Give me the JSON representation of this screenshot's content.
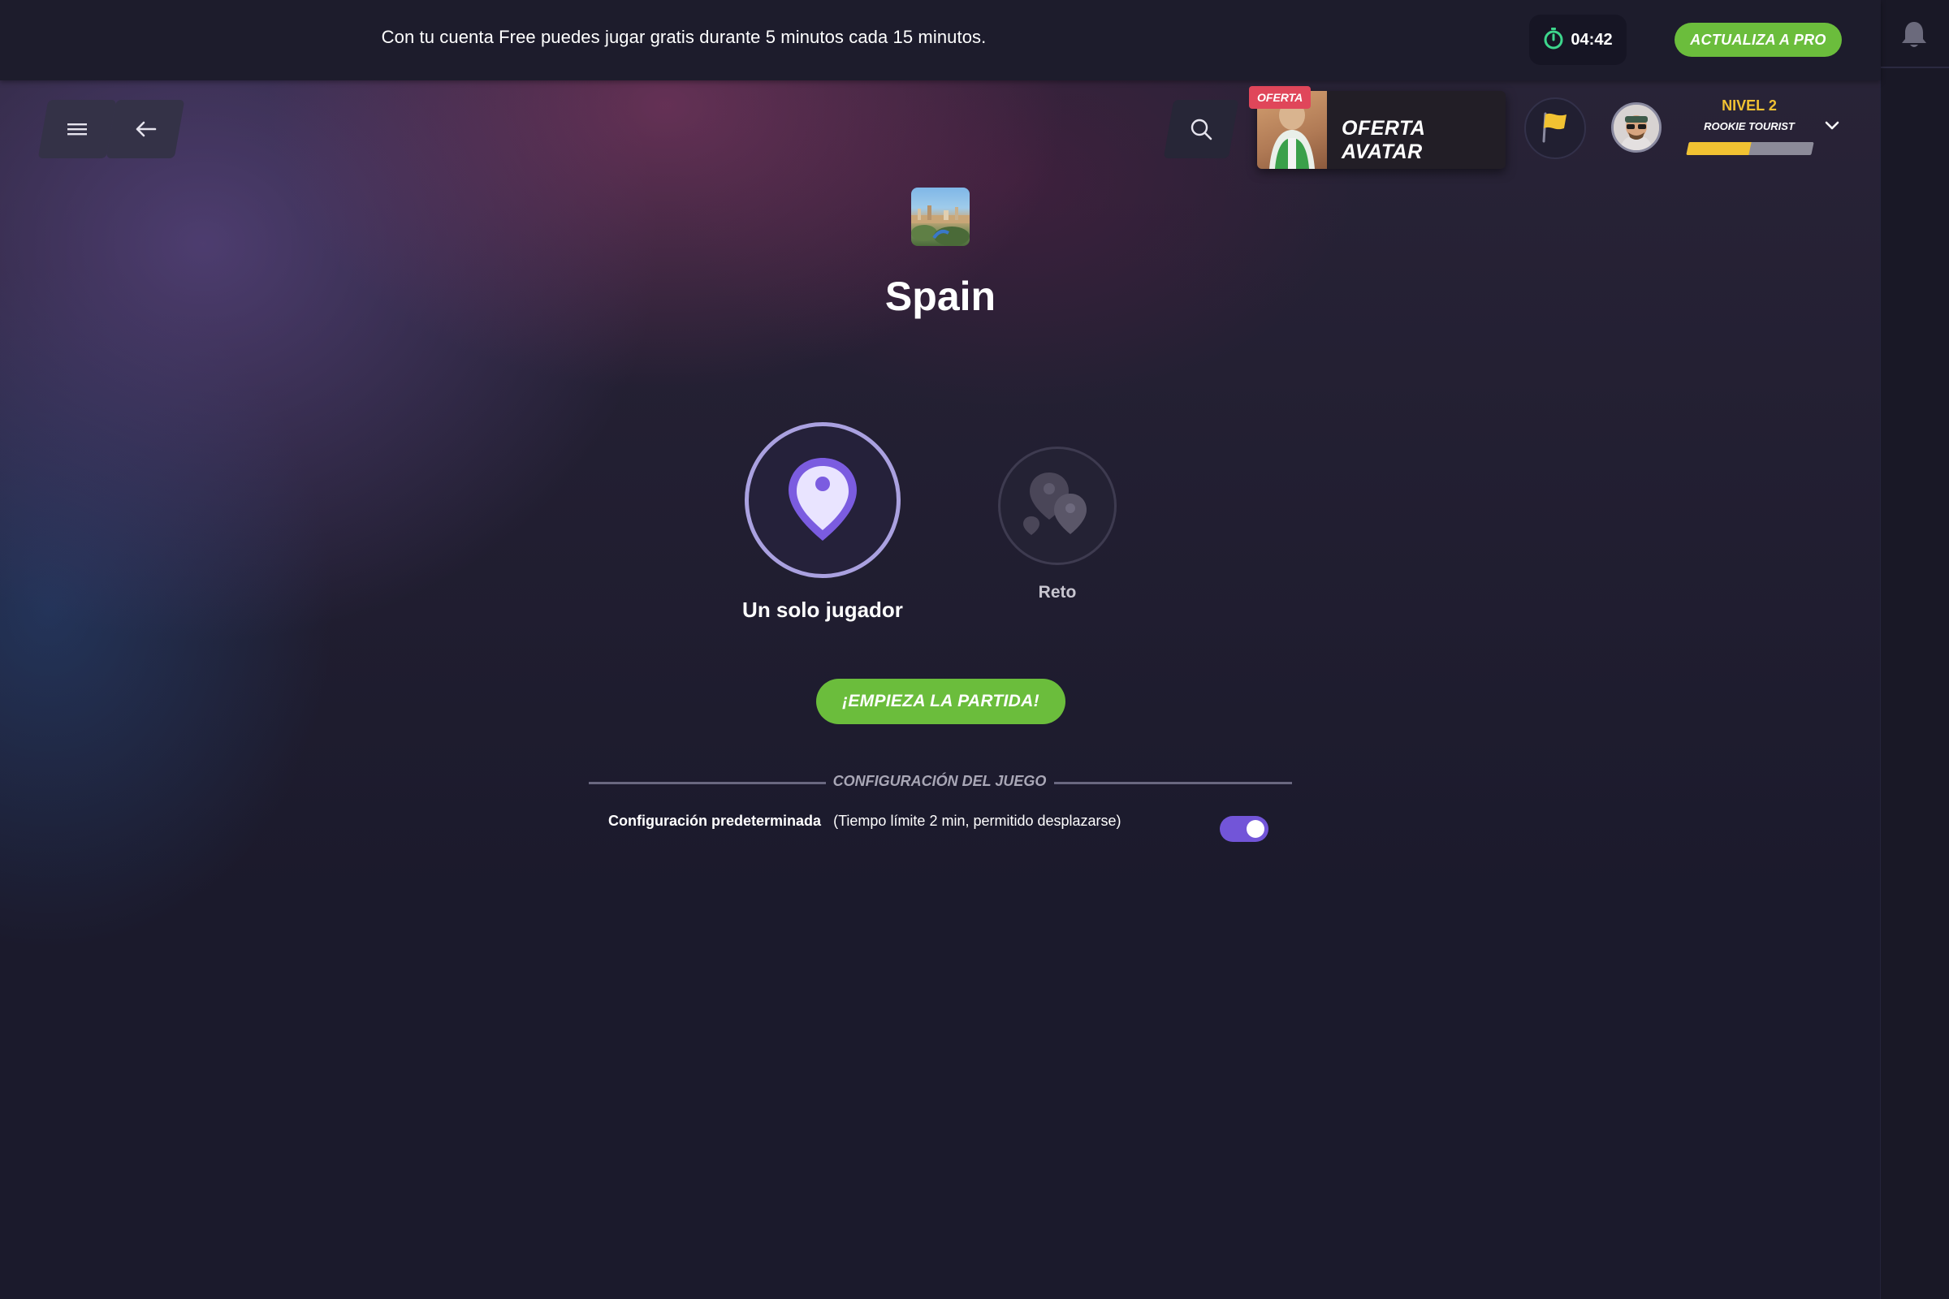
{
  "banner": {
    "message": "Con tu cuenta Free puedes jugar gratis durante 5 minutos cada 15 minutos.",
    "timer": "04:42",
    "timer_icon": "stopwatch-icon",
    "pro_button": "ACTUALIZA A PRO",
    "accent": "#6bbd3c"
  },
  "header": {
    "menu_icon": "hamburger-menu-icon",
    "back_icon": "arrow-left-icon",
    "search_icon": "search-icon",
    "offer": {
      "badge": "OFERTA",
      "title": "OFERTA AVATAR"
    },
    "flag_icon": "yellow-flag-icon",
    "level": {
      "label": "NIVEL 2",
      "title": "ROOKIE TOURIST",
      "progress": 0.5,
      "bar_color": "#f1c232"
    }
  },
  "country": {
    "name": "Spain"
  },
  "modes": {
    "single": {
      "label": "Un solo jugador",
      "selected": true,
      "icon": "map-pin-icon"
    },
    "challenge": {
      "label": "Reto",
      "selected": false,
      "icon": "multi-pin-icon"
    }
  },
  "start_button": "¡EMPIEZA LA PARTIDA!",
  "config": {
    "heading": "CONFIGURACIÓN DEL JUEGO",
    "default_label": "Configuración predeterminada",
    "default_detail": "(Tiempo límite 2 min, permitido desplazarse)",
    "default_enabled": true,
    "toggle_color": "#7255d8"
  },
  "sidebar": {
    "bell_icon": "bell-icon"
  }
}
